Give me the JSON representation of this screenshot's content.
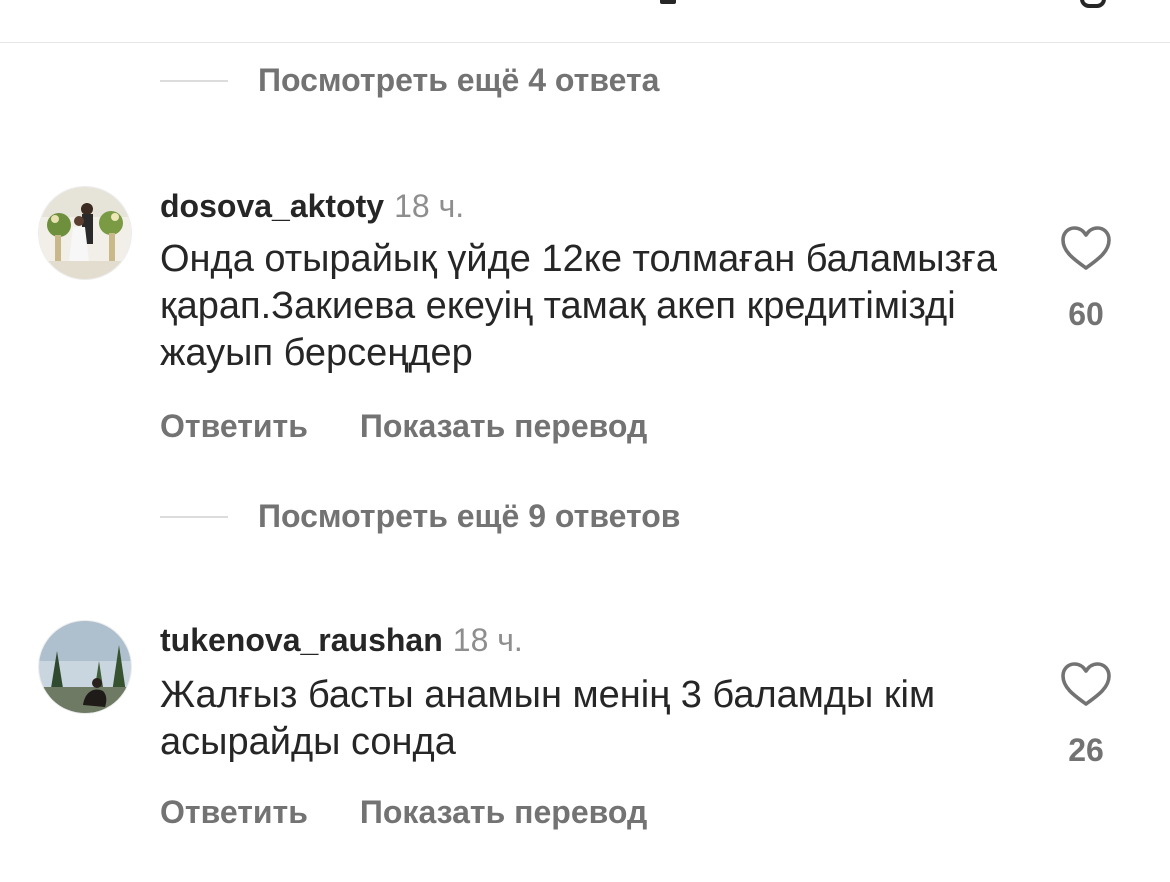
{
  "thread": {
    "view_more_1": "Посмотреть ещё 4 ответа",
    "view_more_2": "Посмотреть ещё 9 ответов"
  },
  "comments": [
    {
      "username": "dosova_aktoty",
      "time": "18 ч.",
      "text": "Онда отырайық үйде  12ке толмаған баламызға қарап.Закиева екеуің тамақ акеп кредитімізді жауып берсеңдер",
      "likes": "60",
      "reply_label": "Ответить",
      "translate_label": "Показать перевод"
    },
    {
      "username": "tukenova_raushan",
      "time": "18 ч.",
      "text": "Жалғыз басты анамын менің 3 баламды кім асырайды сонда",
      "likes": "26",
      "reply_label": "Ответить",
      "translate_label": "Показать перевод"
    }
  ],
  "icons": {
    "like": "heart-outline-icon"
  },
  "colors": {
    "primary_text": "#262626",
    "secondary_text": "#737373",
    "divider": "#e6e6e6"
  }
}
